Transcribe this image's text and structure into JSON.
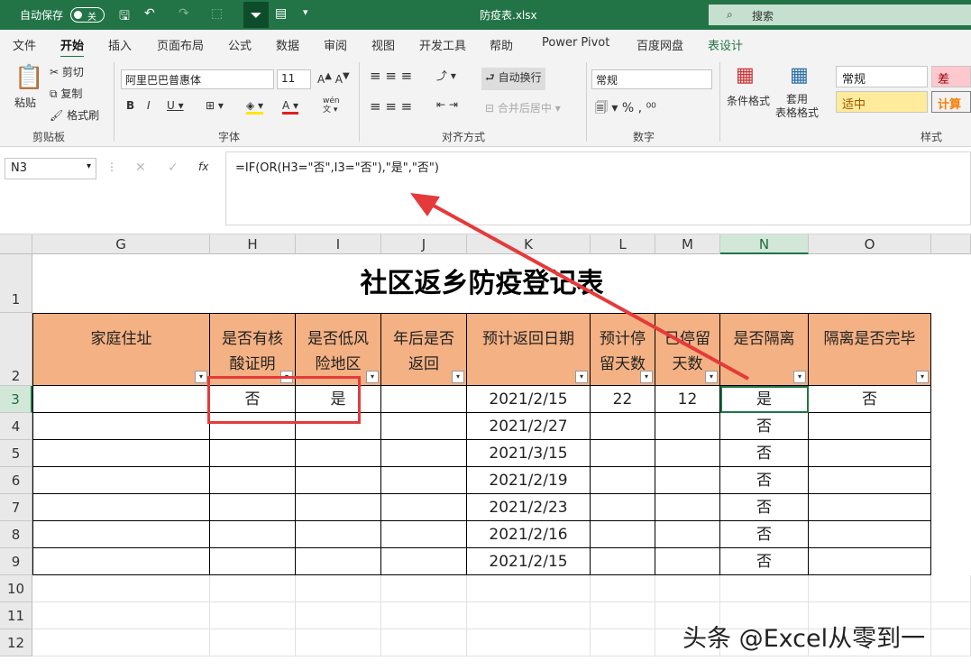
{
  "titlebar": {
    "autosave": "自动保存",
    "toggle": "关",
    "filename": "防疫表.xlsx",
    "search": "搜索"
  },
  "tabs": [
    "文件",
    "开始",
    "插入",
    "页面布局",
    "公式",
    "数据",
    "审阅",
    "视图",
    "开发工具",
    "帮助",
    "Power Pivot",
    "百度网盘",
    "表设计"
  ],
  "ribbon": {
    "paste": "粘贴",
    "cut": "剪切",
    "copy": "复制",
    "format_painter": "格式刷",
    "clipboard": "剪贴板",
    "font_name": "阿里巴巴普惠体",
    "font_size": "11",
    "font_group": "字体",
    "wen": "wén\n文",
    "wrap": "自动换行",
    "merge": "合并后居中",
    "align_group": "对齐方式",
    "numfmt": "常规",
    "number_group": "数字",
    "cond_format": "条件格式",
    "table_format": "套用\n表格格式",
    "styles": {
      "normal": "常规",
      "bad": "差",
      "neutral": "适中",
      "calc": "计算"
    },
    "styles_group": "样式"
  },
  "formula_bar": {
    "namebox": "N3",
    "fx": "fx",
    "formula": "=IF(OR(H3=\"否\",I3=\"否\"),\"是\",\"否\")"
  },
  "columns": [
    "G",
    "H",
    "I",
    "J",
    "K",
    "L",
    "M",
    "N",
    "O"
  ],
  "rows": [
    "1",
    "2",
    "3",
    "4",
    "5",
    "6",
    "7",
    "8",
    "9",
    "10",
    "11",
    "12"
  ],
  "table": {
    "title": "社区返乡防疫登记表",
    "headers": [
      "家庭住址",
      "是否有核\n酸证明",
      "是否低风\n险地区",
      "年后是否\n返回",
      "预计返回日期",
      "预计停\n留天数",
      "已停留\n天数",
      "是否隔离",
      "隔离是否完毕"
    ],
    "rows": [
      [
        "",
        "否",
        "是",
        "",
        "2021/2/15",
        "22",
        "12",
        "是",
        "否"
      ],
      [
        "",
        "",
        "",
        "",
        "2021/2/27",
        "",
        "",
        "否",
        ""
      ],
      [
        "",
        "",
        "",
        "",
        "2021/3/15",
        "",
        "",
        "否",
        ""
      ],
      [
        "",
        "",
        "",
        "",
        "2021/2/19",
        "",
        "",
        "否",
        ""
      ],
      [
        "",
        "",
        "",
        "",
        "2021/2/23",
        "",
        "",
        "否",
        ""
      ],
      [
        "",
        "",
        "",
        "",
        "2021/2/16",
        "",
        "",
        "否",
        ""
      ],
      [
        "",
        "",
        "",
        "",
        "2021/2/15",
        "",
        "",
        "否",
        ""
      ]
    ]
  },
  "watermark": "头条 @Excel从零到一",
  "colors": {
    "excel_green": "#217346",
    "header_fill": "#f4b183",
    "annotation": "#e53a3a"
  }
}
